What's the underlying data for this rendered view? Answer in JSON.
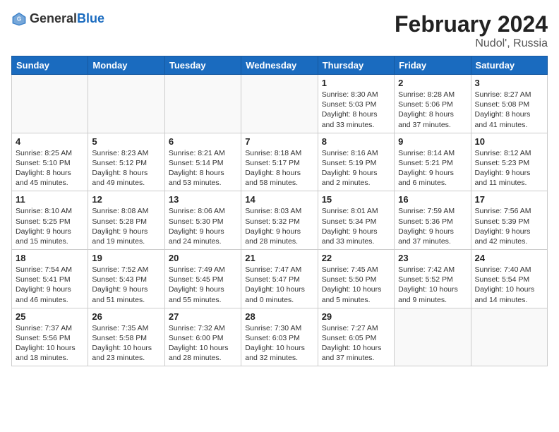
{
  "header": {
    "logo_general": "General",
    "logo_blue": "Blue",
    "month_title": "February 2024",
    "location": "Nudol', Russia"
  },
  "days_of_week": [
    "Sunday",
    "Monday",
    "Tuesday",
    "Wednesday",
    "Thursday",
    "Friday",
    "Saturday"
  ],
  "weeks": [
    [
      {
        "num": "",
        "info": ""
      },
      {
        "num": "",
        "info": ""
      },
      {
        "num": "",
        "info": ""
      },
      {
        "num": "",
        "info": ""
      },
      {
        "num": "1",
        "info": "Sunrise: 8:30 AM\nSunset: 5:03 PM\nDaylight: 8 hours\nand 33 minutes."
      },
      {
        "num": "2",
        "info": "Sunrise: 8:28 AM\nSunset: 5:06 PM\nDaylight: 8 hours\nand 37 minutes."
      },
      {
        "num": "3",
        "info": "Sunrise: 8:27 AM\nSunset: 5:08 PM\nDaylight: 8 hours\nand 41 minutes."
      }
    ],
    [
      {
        "num": "4",
        "info": "Sunrise: 8:25 AM\nSunset: 5:10 PM\nDaylight: 8 hours\nand 45 minutes."
      },
      {
        "num": "5",
        "info": "Sunrise: 8:23 AM\nSunset: 5:12 PM\nDaylight: 8 hours\nand 49 minutes."
      },
      {
        "num": "6",
        "info": "Sunrise: 8:21 AM\nSunset: 5:14 PM\nDaylight: 8 hours\nand 53 minutes."
      },
      {
        "num": "7",
        "info": "Sunrise: 8:18 AM\nSunset: 5:17 PM\nDaylight: 8 hours\nand 58 minutes."
      },
      {
        "num": "8",
        "info": "Sunrise: 8:16 AM\nSunset: 5:19 PM\nDaylight: 9 hours\nand 2 minutes."
      },
      {
        "num": "9",
        "info": "Sunrise: 8:14 AM\nSunset: 5:21 PM\nDaylight: 9 hours\nand 6 minutes."
      },
      {
        "num": "10",
        "info": "Sunrise: 8:12 AM\nSunset: 5:23 PM\nDaylight: 9 hours\nand 11 minutes."
      }
    ],
    [
      {
        "num": "11",
        "info": "Sunrise: 8:10 AM\nSunset: 5:25 PM\nDaylight: 9 hours\nand 15 minutes."
      },
      {
        "num": "12",
        "info": "Sunrise: 8:08 AM\nSunset: 5:28 PM\nDaylight: 9 hours\nand 19 minutes."
      },
      {
        "num": "13",
        "info": "Sunrise: 8:06 AM\nSunset: 5:30 PM\nDaylight: 9 hours\nand 24 minutes."
      },
      {
        "num": "14",
        "info": "Sunrise: 8:03 AM\nSunset: 5:32 PM\nDaylight: 9 hours\nand 28 minutes."
      },
      {
        "num": "15",
        "info": "Sunrise: 8:01 AM\nSunset: 5:34 PM\nDaylight: 9 hours\nand 33 minutes."
      },
      {
        "num": "16",
        "info": "Sunrise: 7:59 AM\nSunset: 5:36 PM\nDaylight: 9 hours\nand 37 minutes."
      },
      {
        "num": "17",
        "info": "Sunrise: 7:56 AM\nSunset: 5:39 PM\nDaylight: 9 hours\nand 42 minutes."
      }
    ],
    [
      {
        "num": "18",
        "info": "Sunrise: 7:54 AM\nSunset: 5:41 PM\nDaylight: 9 hours\nand 46 minutes."
      },
      {
        "num": "19",
        "info": "Sunrise: 7:52 AM\nSunset: 5:43 PM\nDaylight: 9 hours\nand 51 minutes."
      },
      {
        "num": "20",
        "info": "Sunrise: 7:49 AM\nSunset: 5:45 PM\nDaylight: 9 hours\nand 55 minutes."
      },
      {
        "num": "21",
        "info": "Sunrise: 7:47 AM\nSunset: 5:47 PM\nDaylight: 10 hours\nand 0 minutes."
      },
      {
        "num": "22",
        "info": "Sunrise: 7:45 AM\nSunset: 5:50 PM\nDaylight: 10 hours\nand 5 minutes."
      },
      {
        "num": "23",
        "info": "Sunrise: 7:42 AM\nSunset: 5:52 PM\nDaylight: 10 hours\nand 9 minutes."
      },
      {
        "num": "24",
        "info": "Sunrise: 7:40 AM\nSunset: 5:54 PM\nDaylight: 10 hours\nand 14 minutes."
      }
    ],
    [
      {
        "num": "25",
        "info": "Sunrise: 7:37 AM\nSunset: 5:56 PM\nDaylight: 10 hours\nand 18 minutes."
      },
      {
        "num": "26",
        "info": "Sunrise: 7:35 AM\nSunset: 5:58 PM\nDaylight: 10 hours\nand 23 minutes."
      },
      {
        "num": "27",
        "info": "Sunrise: 7:32 AM\nSunset: 6:00 PM\nDaylight: 10 hours\nand 28 minutes."
      },
      {
        "num": "28",
        "info": "Sunrise: 7:30 AM\nSunset: 6:03 PM\nDaylight: 10 hours\nand 32 minutes."
      },
      {
        "num": "29",
        "info": "Sunrise: 7:27 AM\nSunset: 6:05 PM\nDaylight: 10 hours\nand 37 minutes."
      },
      {
        "num": "",
        "info": ""
      },
      {
        "num": "",
        "info": ""
      }
    ]
  ]
}
